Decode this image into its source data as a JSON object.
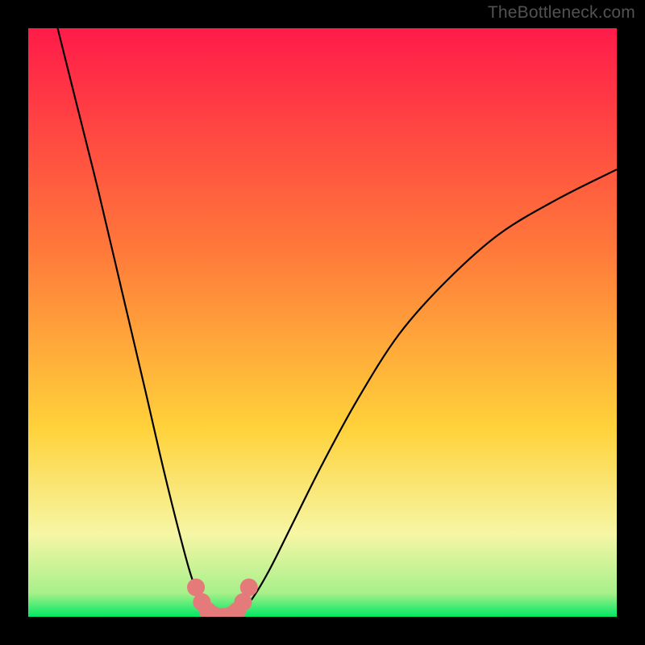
{
  "watermark": "TheBottleneck.com",
  "colors": {
    "bg": "#000000",
    "grad_top": "#ff1b49",
    "grad_mid1": "#ff7a3a",
    "grad_mid2": "#ffd23a",
    "grad_pale": "#f6f6a5",
    "grad_green": "#00e863",
    "curve": "#000000",
    "marker": "#e47a7a"
  },
  "chart_data": {
    "type": "line",
    "title": "",
    "xlabel": "",
    "ylabel": "",
    "xlim": [
      0,
      100
    ],
    "ylim": [
      0,
      100
    ],
    "series": [
      {
        "name": "curve-left",
        "x": [
          5,
          8,
          12,
          16,
          20,
          23,
          26,
          28,
          30,
          31,
          32
        ],
        "y": [
          100,
          88,
          72,
          55,
          38,
          25,
          13,
          6,
          2,
          1,
          0
        ]
      },
      {
        "name": "curve-right-flat",
        "x": [
          32,
          33,
          35,
          36
        ],
        "y": [
          0,
          0,
          0,
          1
        ]
      },
      {
        "name": "curve-right",
        "x": [
          36,
          38,
          41,
          45,
          50,
          56,
          63,
          71,
          80,
          90,
          100
        ],
        "y": [
          1,
          3,
          8,
          16,
          26,
          37,
          48,
          57,
          65,
          71,
          76
        ]
      }
    ],
    "markers": {
      "name": "bottom-markers",
      "x": [
        28.5,
        29.5,
        30.5,
        31.5,
        33.0,
        34.5,
        35.5,
        36.5,
        37.5
      ],
      "y": [
        5.0,
        2.5,
        1.0,
        0.3,
        0.0,
        0.3,
        1.0,
        2.5,
        5.0
      ]
    },
    "gradient_stops": [
      {
        "offset": 0.0,
        "color": "#ff1b49"
      },
      {
        "offset": 0.38,
        "color": "#ff7a3a"
      },
      {
        "offset": 0.68,
        "color": "#ffd23a"
      },
      {
        "offset": 0.86,
        "color": "#f6f6a5"
      },
      {
        "offset": 0.96,
        "color": "#a7f08a"
      },
      {
        "offset": 1.0,
        "color": "#00e863"
      }
    ]
  }
}
